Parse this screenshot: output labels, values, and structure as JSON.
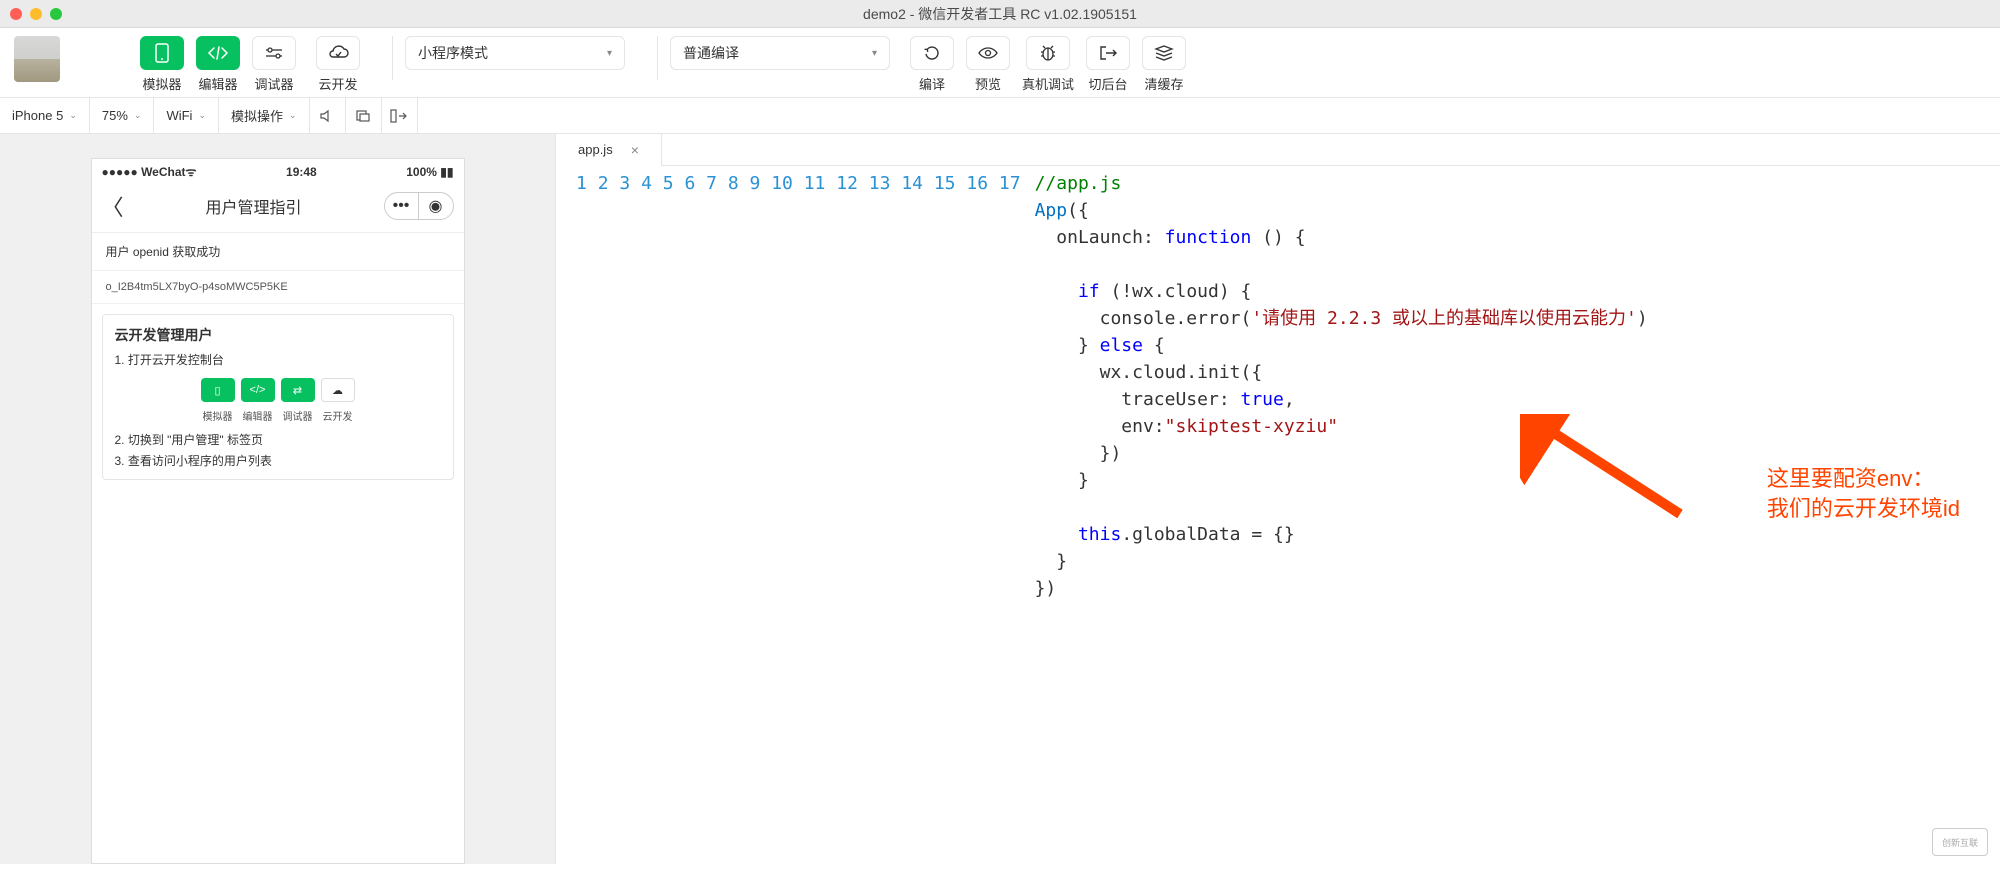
{
  "window": {
    "title": "demo2 - 微信开发者工具 RC v1.02.1905151"
  },
  "toolbar": {
    "simulator": "模拟器",
    "editor": "编辑器",
    "debugger": "调试器",
    "cloud": "云开发",
    "mode_select": "小程序模式",
    "compile_select": "普通编译",
    "compile": "编译",
    "preview": "预览",
    "remote_debug": "真机调试",
    "background": "切后台",
    "clear_cache": "清缓存"
  },
  "secbar": {
    "device": "iPhone 5",
    "zoom": "75%",
    "network": "WiFi",
    "mock": "模拟操作"
  },
  "phone": {
    "carrier": "●●●●● WeChat",
    "wifi_icon": "ᯤ",
    "time": "19:48",
    "battery": "100%",
    "nav_title": "用户管理指引",
    "row1": "用户 openid 获取成功",
    "row2": "o_I2B4tm5LX7byO-p4soMWC5P5KE",
    "card_title": "云开发管理用户",
    "step1": "1. 打开云开发控制台",
    "step2": "2. 切换到 \"用户管理\" 标签页",
    "step3": "3. 查看访问小程序的用户列表",
    "mini": {
      "sim": "模拟器",
      "ed": "编辑器",
      "dbg": "调试器",
      "cloud": "云开发"
    }
  },
  "editor": {
    "filename": "app.js",
    "code": {
      "l1_comment": "//app.js",
      "l2_a": "App",
      "l2_b": "({",
      "l3_a": "  onLaunch: ",
      "l3_b": "function",
      "l3_c": " () {",
      "l4": "",
      "l5_a": "    ",
      "l5_b": "if",
      "l5_c": " (!wx.cloud) {",
      "l6_a": "      console.error(",
      "l6_b": "'请使用 2.2.3 或以上的基础库以使用云能力'",
      "l6_c": ")",
      "l7_a": "    } ",
      "l7_b": "else",
      "l7_c": " {",
      "l8": "      wx.cloud.init({",
      "l9_a": "        traceUser: ",
      "l9_b": "true",
      "l9_c": ",",
      "l10_a": "        env:",
      "l10_b": "\"skiptest-xyziu\"",
      "l11": "      })",
      "l12": "    }",
      "l13": "",
      "l14_a": "    ",
      "l14_b": "this",
      "l14_c": ".globalData = {}",
      "l15": "  }",
      "l16": "})",
      "l17": ""
    },
    "line_numbers": [
      "1",
      "2",
      "3",
      "4",
      "5",
      "6",
      "7",
      "8",
      "9",
      "10",
      "11",
      "12",
      "13",
      "14",
      "15",
      "16",
      "17"
    ]
  },
  "annotation": {
    "line1": "这里要配资env：",
    "line2": "我们的云开发环境id"
  },
  "watermark": "创新互联"
}
